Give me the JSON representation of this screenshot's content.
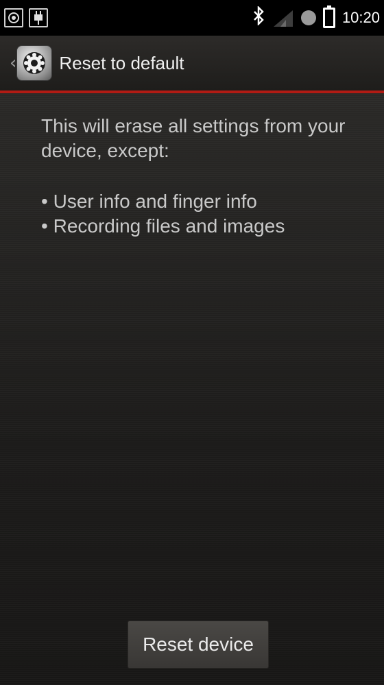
{
  "status_bar": {
    "left_icons": [
      "target-icon",
      "usb-plug-icon"
    ],
    "right_icons": [
      "bluetooth-icon",
      "signal-icon",
      "status-dot-icon",
      "battery-icon"
    ],
    "time": "10:20"
  },
  "action_bar": {
    "back_glyph": "‹",
    "app_icon": "settings-gear-icon",
    "title": "Reset to default",
    "accent_color": "#b11b14"
  },
  "content": {
    "intro": "This will erase all settings from your device, except:",
    "bullets": [
      "User info and finger info",
      "Recording files and images"
    ]
  },
  "reset_button": {
    "label": "Reset device"
  }
}
